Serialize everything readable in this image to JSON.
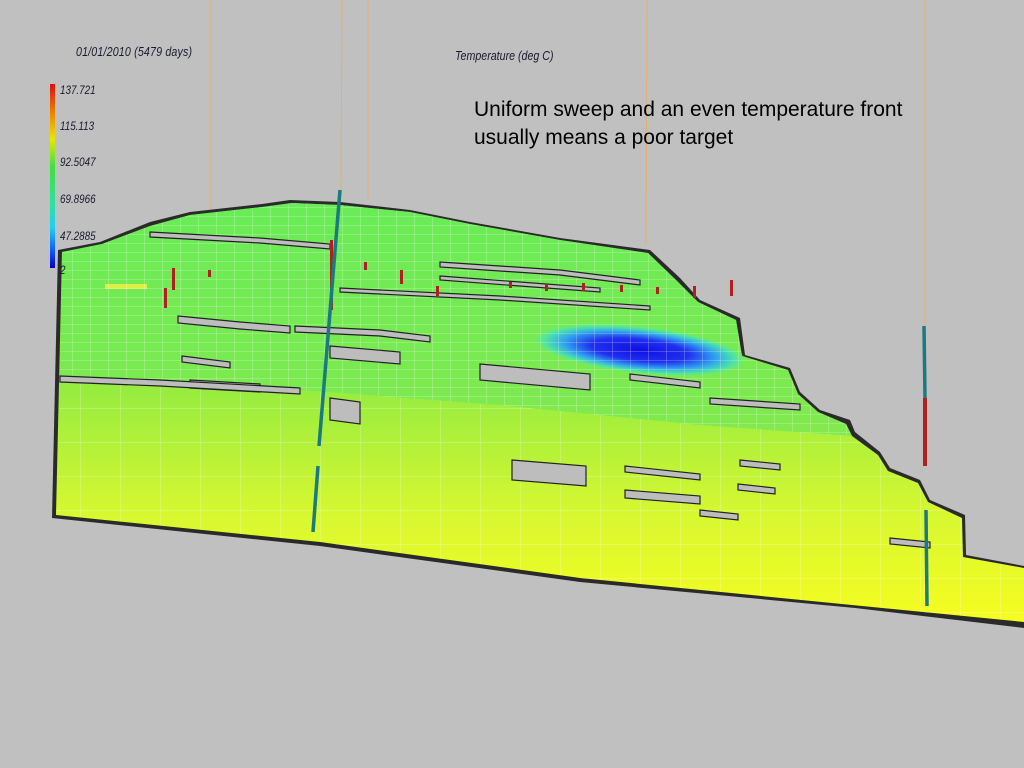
{
  "view": {
    "timestamp": "01/01/2010 (5479 days)",
    "property": "Temperature (deg C)"
  },
  "colorbar": {
    "ticks": [
      "137.721",
      "115.113",
      "92.5047",
      "69.8966",
      "47.2885",
      "2"
    ],
    "colors": {
      "high": "#e01010",
      "mid_high": "#e8e800",
      "mid": "#40e040",
      "mid_low": "#20d0f0",
      "low": "#0000c0"
    }
  },
  "annotation": {
    "text_line1": "Uniform  sweep and an even temperature front",
    "text_line2": "usually means a poor target"
  },
  "wells": {
    "producer_color": "#1a7a80",
    "perforation_color": "#b02020",
    "trajectory_color": "#e0b070"
  }
}
